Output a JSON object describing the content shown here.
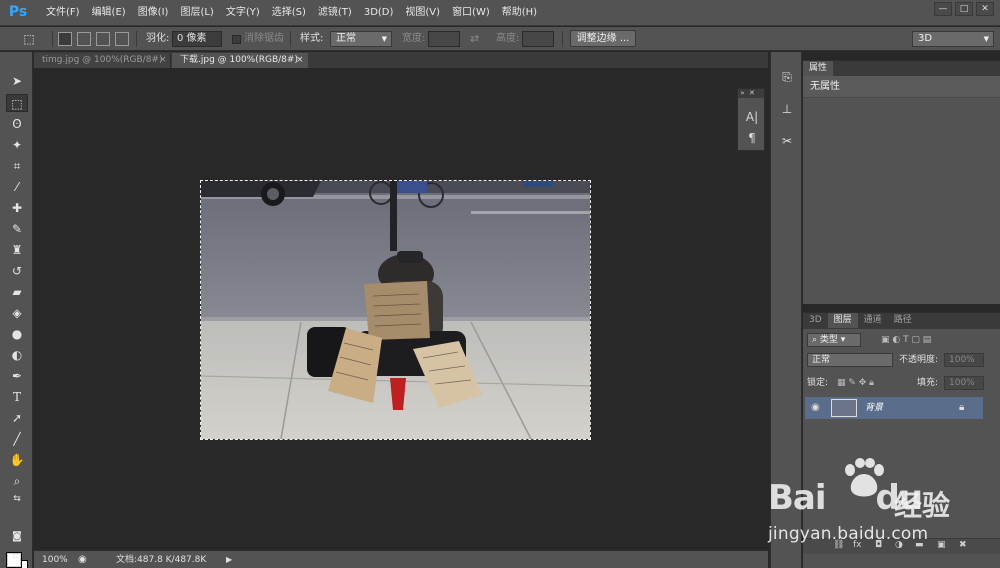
{
  "app": {
    "logo": "Ps"
  },
  "menu": [
    "文件(F)",
    "编辑(E)",
    "图像(I)",
    "图层(L)",
    "文字(Y)",
    "选择(S)",
    "滤镜(T)",
    "3D(D)",
    "视图(V)",
    "窗口(W)",
    "帮助(H)"
  ],
  "window_controls": {
    "minimize": "—",
    "restore": "□",
    "close": "✕"
  },
  "options": {
    "feather_label": "羽化:",
    "feather_value": "0 像素",
    "antialias_label": "消除锯齿",
    "style_label": "样式:",
    "style_value": "正常",
    "width_label": "宽度:",
    "height_label": "高度:",
    "refine_edge_button": "调整边缘 ...",
    "workspace_value": "3D"
  },
  "tabs": [
    {
      "label": "timg.jpg @ 100%(RGB/8#)",
      "active": false,
      "close": "×"
    },
    {
      "label": "下载.jpg @ 100%(RGB/8#)",
      "active": true,
      "close": "×"
    }
  ],
  "status": {
    "zoom": "100%",
    "doc_info": "文档:487.8 K/487.8K",
    "arrow": "▶"
  },
  "char_panel": {
    "char_icon": "A|",
    "para_icon": "¶"
  },
  "properties_panel": {
    "tab_label": "属性",
    "body_text": "无属性"
  },
  "layers_panel": {
    "tabs": [
      "3D",
      "图层",
      "通道",
      "路径"
    ],
    "active_tab": "图层",
    "filter_label": "类型",
    "blend_mode": "正常",
    "opacity_label": "不透明度:",
    "opacity_value": "100%",
    "lock_label": "锁定:",
    "fill_label": "填充:",
    "fill_value": "100%",
    "layer_name": "背景"
  },
  "colors": {
    "panel_bg": "#535353",
    "canvas_bg": "#282828",
    "selected_layer": "#5a6d8b",
    "ps_blue": "#31a8ff"
  },
  "icons": {
    "tools": [
      "move-icon",
      "marquee-icon",
      "lasso-icon",
      "magic-wand-icon",
      "crop-icon",
      "eyedropper-icon",
      "healing-icon",
      "brush-icon",
      "clone-stamp-icon",
      "history-brush-icon",
      "eraser-icon",
      "paint-bucket-icon",
      "blur-icon",
      "dodge-icon",
      "pen-icon",
      "type-icon",
      "path-select-icon",
      "line-icon",
      "hand-icon",
      "zoom-icon"
    ]
  },
  "watermark": {
    "brand": "Bai",
    "brand_tail": "du",
    "cn": "经验",
    "url": "jingyan.baidu.com"
  }
}
